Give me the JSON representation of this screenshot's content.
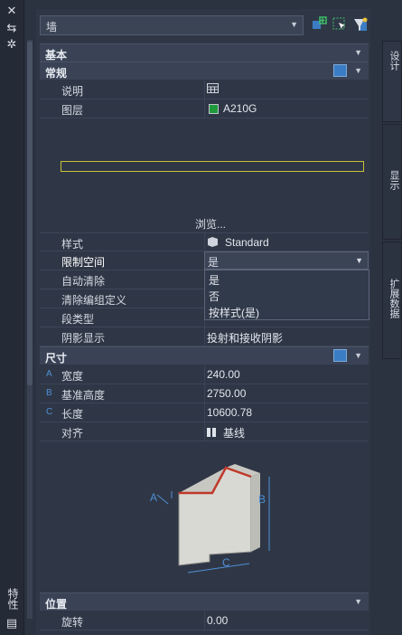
{
  "left_strip": {
    "title": "特性"
  },
  "header": {
    "object_type": "墙"
  },
  "tabs": [
    "设计",
    "显示",
    "扩展数据"
  ],
  "sections": {
    "basic": "基本",
    "general": "常规",
    "dimensions": "尺寸",
    "location": "位置"
  },
  "general_rows": [
    {
      "label": "说明",
      "value": ""
    },
    {
      "label": "图层",
      "value": "A210G"
    }
  ],
  "browse_label": "浏览...",
  "general_rows2": [
    {
      "label": "样式",
      "value": "Standard"
    },
    {
      "label": "限制空间",
      "value": "是"
    },
    {
      "label": "自动清除",
      "value": ""
    },
    {
      "label": "清除编组定义",
      "value": ""
    },
    {
      "label": "段类型",
      "value": ""
    },
    {
      "label": "阴影显示",
      "value": "投射和接收阴影"
    }
  ],
  "dropdown_options": [
    "是",
    "否",
    "按样式(是)"
  ],
  "dimension_rows": [
    {
      "mark": "A",
      "label": "宽度",
      "value": "240.00"
    },
    {
      "mark": "B",
      "label": "基准高度",
      "value": "2750.00"
    },
    {
      "mark": "C",
      "label": "长度",
      "value": "10600.78"
    },
    {
      "mark": "",
      "label": "对齐",
      "value": "基线"
    }
  ],
  "diagram_labels": {
    "a": "A",
    "b": "B",
    "c": "C"
  },
  "location_rows": [
    {
      "label": "旋转",
      "value": "0.00"
    }
  ],
  "colors": {
    "accent": "#3b7dc4",
    "layer_swatch": "#1f9a3a",
    "highlight": "#c8c03a"
  }
}
